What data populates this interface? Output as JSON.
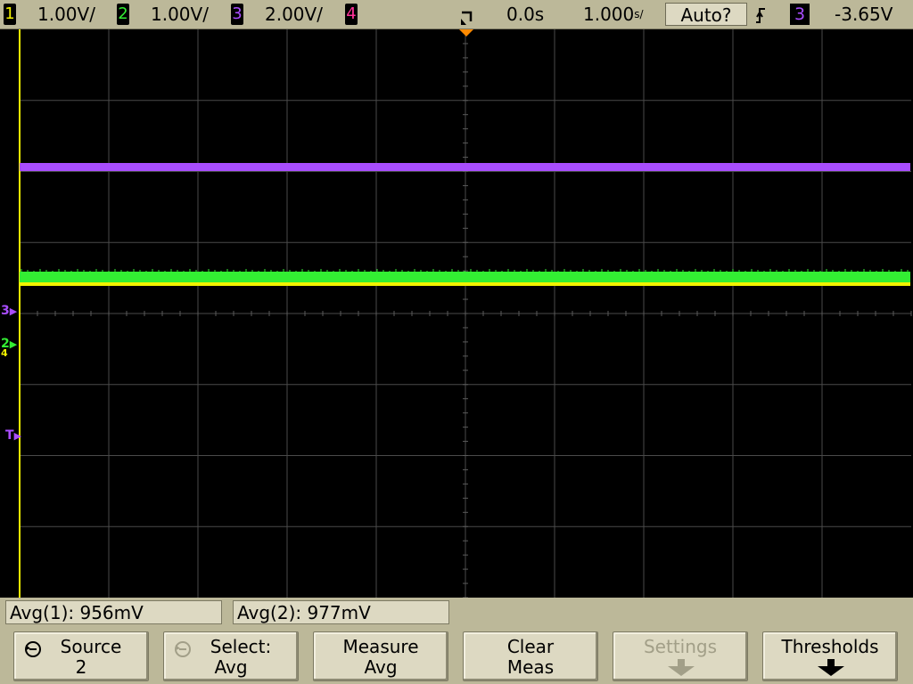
{
  "topbar": {
    "ch1": {
      "num": "1",
      "scale": "1.00V/",
      "color": "#f2f200"
    },
    "ch2": {
      "num": "2",
      "scale": "1.00V/",
      "color": "#33ee33"
    },
    "ch3": {
      "num": "3",
      "scale": "2.00V/",
      "color": "#a94dff"
    },
    "ch4": {
      "num": "4",
      "color": "#ff3399"
    },
    "time_delay": "0.0s",
    "time_scale": "1.000",
    "time_unit": "s/",
    "trigger_mode": "Auto?",
    "trigger_slope_icon": "rising-edge-icon",
    "trigger_source": "3",
    "trigger_level": "-3.65V"
  },
  "screen": {
    "ch1_trace_color": "#f2f200",
    "ch2_trace_color": "#33ee33",
    "ch3_trace_color": "#a94dff",
    "ground_marker_3": "3",
    "ground_marker_2": "2",
    "ground_marker_4": "4",
    "trigger_marker": "T"
  },
  "measurements": [
    {
      "label": "Avg(1): 956mV"
    },
    {
      "label": "Avg(2): 977mV"
    }
  ],
  "softkeys": [
    {
      "line1": "Source",
      "line2": "2",
      "icon": "rotate-knob-icon",
      "enabled": true
    },
    {
      "line1": "Select:",
      "line2": "Avg",
      "icon": "rotate-knob-icon",
      "enabled": false
    },
    {
      "line1": "Measure",
      "line2": "Avg",
      "enabled": true
    },
    {
      "line1": "Clear",
      "line2": "Meas",
      "enabled": true
    },
    {
      "line1": "Settings",
      "icon": "down-arrow-icon",
      "enabled": false
    },
    {
      "line1": "Thresholds",
      "icon": "down-arrow-icon",
      "enabled": true
    }
  ]
}
